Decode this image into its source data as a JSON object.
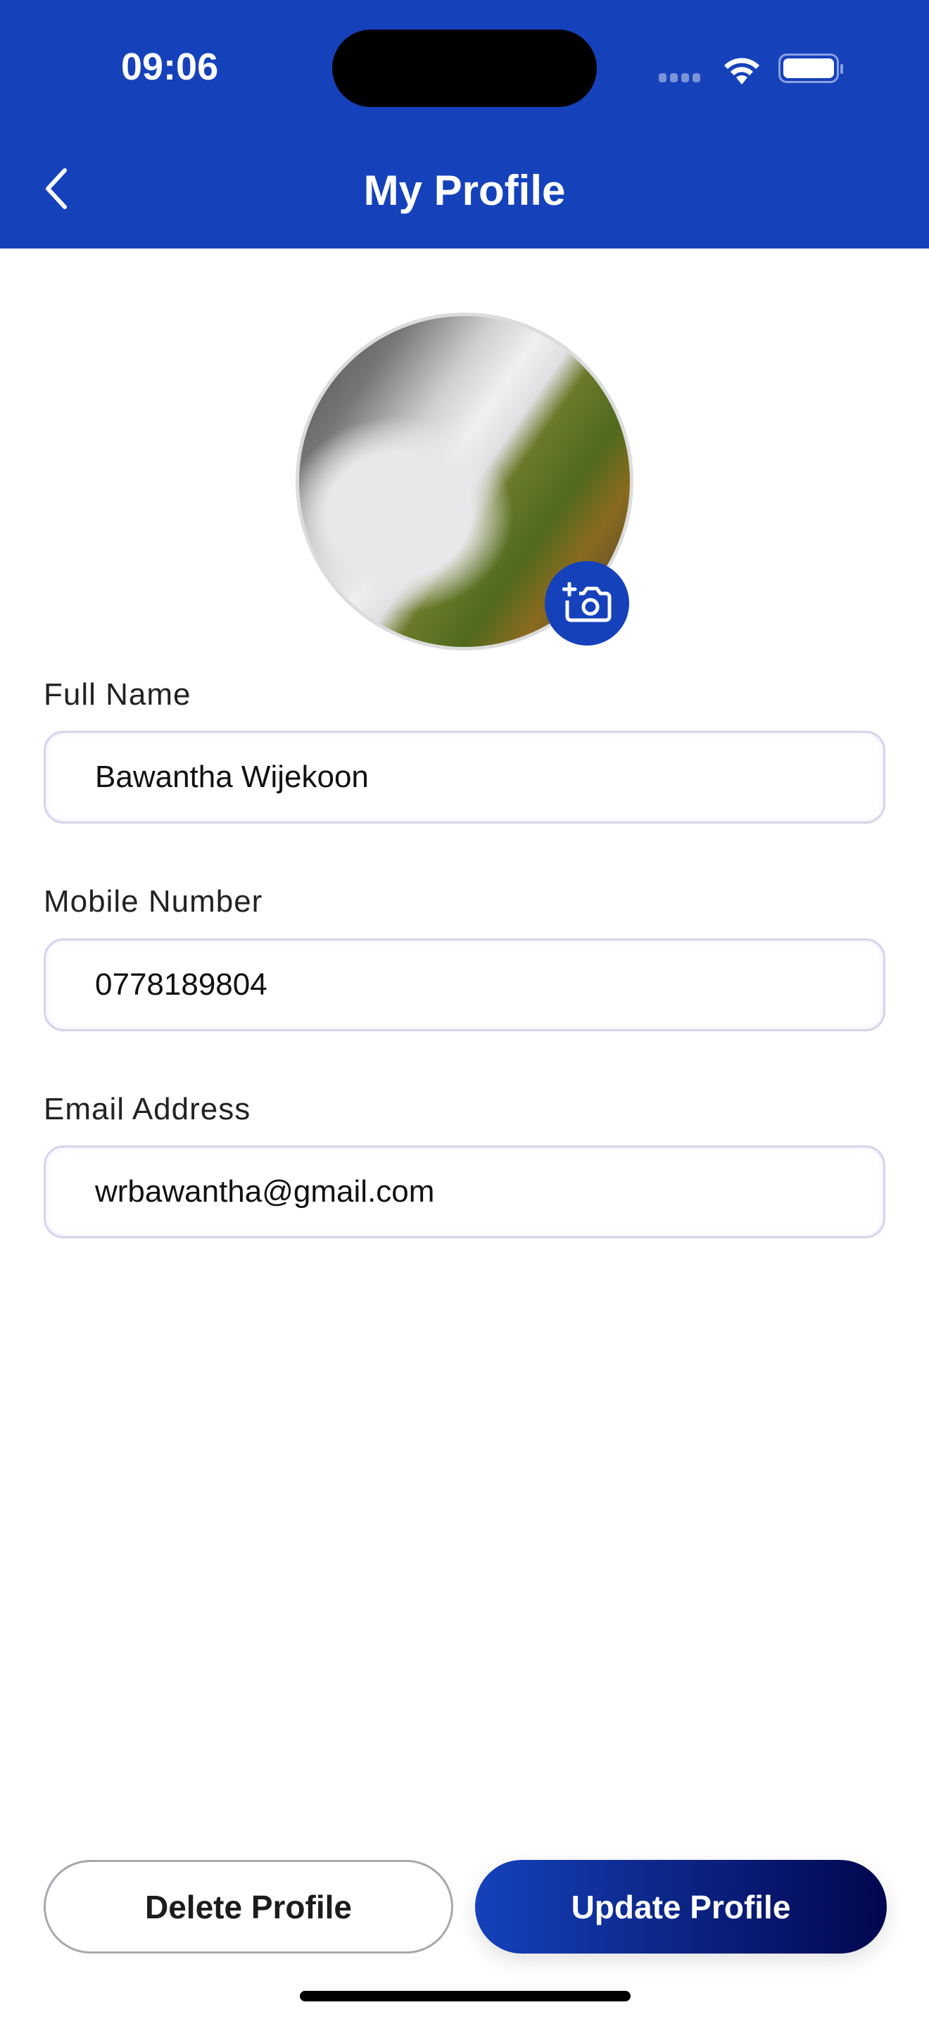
{
  "status_bar": {
    "time": "09:06"
  },
  "header": {
    "title": "My Profile"
  },
  "form": {
    "full_name": {
      "label": "Full Name",
      "value": "Bawantha Wijekoon"
    },
    "mobile": {
      "label": "Mobile Number",
      "value": "0778189804"
    },
    "email": {
      "label": "Email Address",
      "value": "wrbawantha@gmail.com"
    }
  },
  "actions": {
    "delete_label": "Delete Profile",
    "update_label": "Update Profile"
  },
  "colors": {
    "primary": "#1542bb",
    "gradient_end": "#02064f"
  }
}
